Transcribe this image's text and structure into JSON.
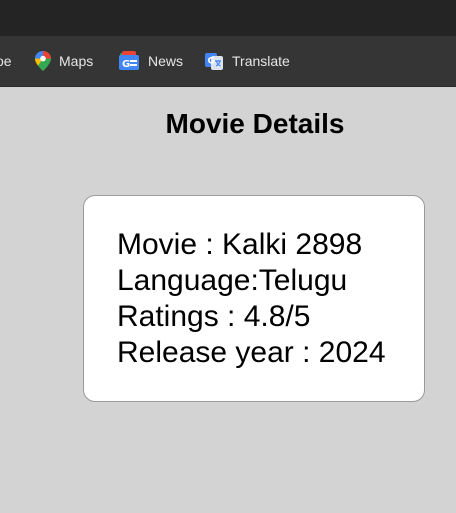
{
  "bookmarks": [
    {
      "label": "oe",
      "icon": "youtube-icon"
    },
    {
      "label": "Maps",
      "icon": "maps-icon"
    },
    {
      "label": "News",
      "icon": "news-icon"
    },
    {
      "label": "Translate",
      "icon": "translate-icon"
    }
  ],
  "page": {
    "title": "Movie Details"
  },
  "card": {
    "movie_line": "Movie : Kalki 2898",
    "language_line": "Language:Telugu",
    "ratings_line": "Ratings : 4.8/5",
    "release_line": "Release year : 2024"
  }
}
